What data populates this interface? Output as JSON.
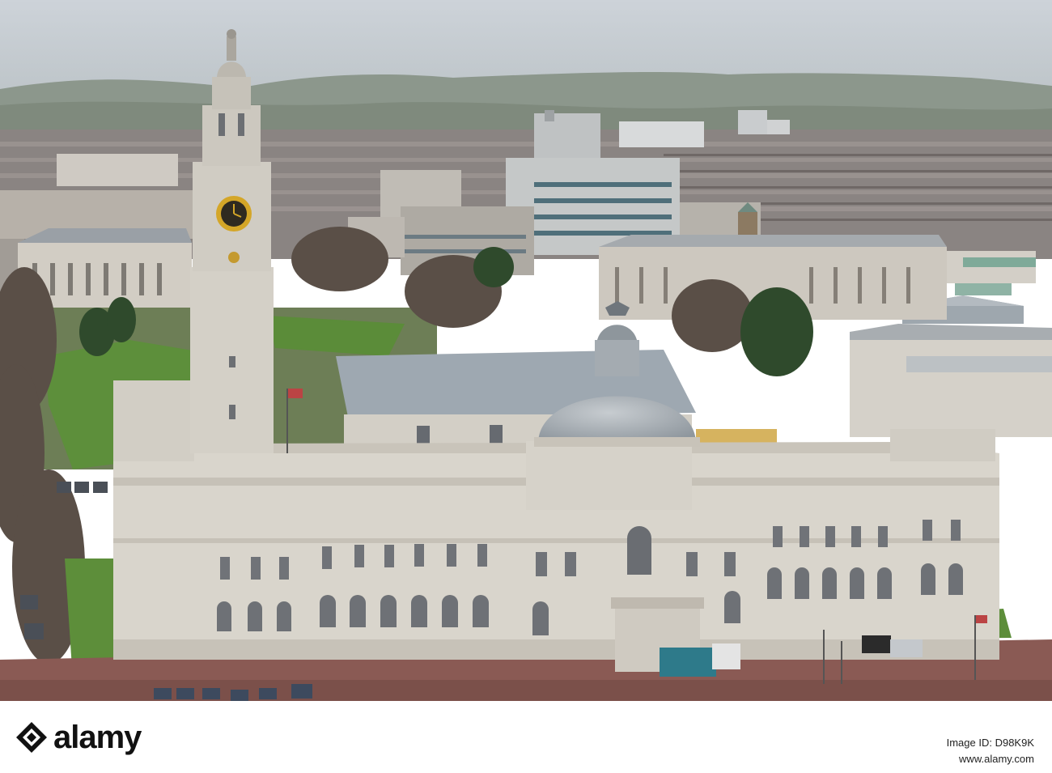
{
  "footer": {
    "logo_text": "alamy",
    "image_id_label": "Image ID: D98K9K",
    "url": "www.alamy.com"
  },
  "colors": {
    "sky": "#c9cfd5",
    "hills": "#8f9a8e",
    "stone": "#d9d6cf",
    "dome": "#a9b0b6",
    "roof": "#9aa4ad",
    "lawn": "#5f8f3e",
    "road": "#8b5a52",
    "clock_face": "#d4a628",
    "window_ochre": "#d9b766"
  },
  "photo": {
    "icon": "city-hall-aerial-photo"
  }
}
